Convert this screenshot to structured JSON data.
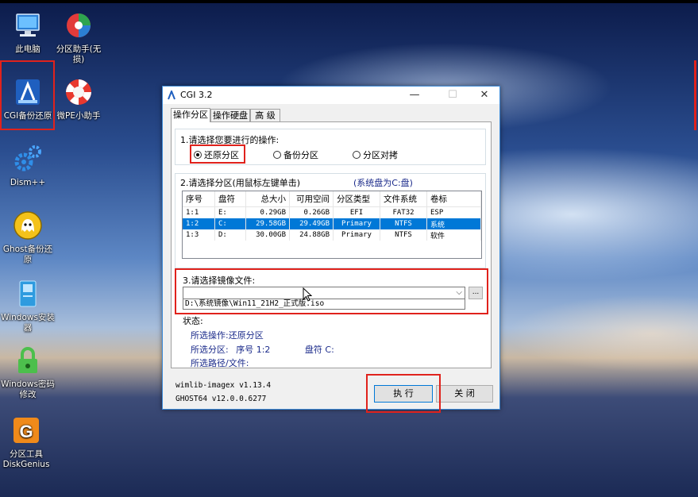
{
  "desktop": {
    "icons": [
      {
        "label": "此电脑"
      },
      {
        "label": "分区助手(无损)"
      },
      {
        "label": "CGI备份还原"
      },
      {
        "label": "微PE小助手"
      },
      {
        "label": "Dism++"
      },
      {
        "label": "Ghost备份还原"
      },
      {
        "label": "Windows安装器"
      },
      {
        "label": "Windows密码修改"
      },
      {
        "label": "分区工具DiskGenius"
      }
    ]
  },
  "window": {
    "title": "CGI 3.2",
    "controls": {
      "minimize": "—",
      "maximize": "☐",
      "close": "✕"
    },
    "tabs": [
      {
        "label": "操作分区",
        "active": true
      },
      {
        "label": "操作硬盘",
        "active": false
      },
      {
        "label": "高 级",
        "active": false
      }
    ],
    "step1": {
      "label": "1.请选择您要进行的操作:",
      "options": [
        {
          "label": "还原分区",
          "selected": true
        },
        {
          "label": "备份分区",
          "selected": false
        },
        {
          "label": "分区对拷",
          "selected": false
        }
      ]
    },
    "step2": {
      "label": "2.请选择分区(用鼠标左键单击)",
      "system_note": "(系统盘为C:盘)",
      "columns": [
        "序号",
        "盘符",
        "总大小",
        "可用空间",
        "分区类型",
        "文件系统",
        "卷标"
      ],
      "rows": [
        {
          "idx": "1:1",
          "drive": "E:",
          "total": "0.29GB",
          "free": "0.26GB",
          "ptype": "EFI",
          "fs": "FAT32",
          "label": "ESP",
          "selected": false
        },
        {
          "idx": "1:2",
          "drive": "C:",
          "total": "29.58GB",
          "free": "29.49GB",
          "ptype": "Primary",
          "fs": "NTFS",
          "label": "系统",
          "selected": true
        },
        {
          "idx": "1:3",
          "drive": "D:",
          "total": "30.00GB",
          "free": "24.88GB",
          "ptype": "Primary",
          "fs": "NTFS",
          "label": "软件",
          "selected": false
        }
      ]
    },
    "step3": {
      "label": "3.请选择镜像文件:",
      "value": "",
      "dropdown_item": "D:\\系统镜像\\Win11_21H2_正式版.iso",
      "browse_label": "..."
    },
    "status": {
      "heading": "状态:",
      "op_label": "所选操作:",
      "op_value": "还原分区",
      "part_label": "所选分区:",
      "part_idx": "序号 1:2",
      "part_drive": "盘符 C:",
      "path_label": "所选路径/文件:",
      "path_value": ""
    },
    "footer": {
      "version1": "wimlib-imagex v1.13.4",
      "version2": "GHOST64 v12.0.0.6277",
      "execute_label": "执 行",
      "close_label": "关 闭"
    }
  },
  "colors": {
    "highlight": "#e0221c",
    "selection": "#0078d7",
    "accent_text": "#1a2a8a"
  }
}
